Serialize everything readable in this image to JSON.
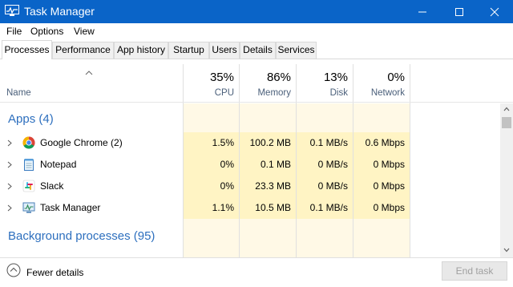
{
  "window": {
    "title": "Task Manager",
    "app_icon": "task-manager-icon"
  },
  "menu": [
    "File",
    "Options",
    "View"
  ],
  "tabs": [
    {
      "label": "Processes",
      "active": true
    },
    {
      "label": "Performance",
      "active": false
    },
    {
      "label": "App history",
      "active": false
    },
    {
      "label": "Startup",
      "active": false
    },
    {
      "label": "Users",
      "active": false
    },
    {
      "label": "Details",
      "active": false
    },
    {
      "label": "Services",
      "active": false
    }
  ],
  "columns": {
    "name": {
      "label": "Name"
    },
    "cpu": {
      "percent": "35%",
      "label": "CPU"
    },
    "memory": {
      "percent": "86%",
      "label": "Memory"
    },
    "disk": {
      "percent": "13%",
      "label": "Disk"
    },
    "network": {
      "percent": "0%",
      "label": "Network"
    }
  },
  "groups": {
    "apps": {
      "title": "Apps (4)",
      "rows": [
        {
          "name": "Google Chrome (2)",
          "icon": "chrome-icon",
          "cpu": "1.5%",
          "memory": "100.2 MB",
          "disk": "0.1 MB/s",
          "network": "0.6 Mbps"
        },
        {
          "name": "Notepad",
          "icon": "notepad-icon",
          "cpu": "0%",
          "memory": "0.1 MB",
          "disk": "0 MB/s",
          "network": "0 Mbps"
        },
        {
          "name": "Slack",
          "icon": "slack-icon",
          "cpu": "0%",
          "memory": "23.3 MB",
          "disk": "0 MB/s",
          "network": "0 Mbps"
        },
        {
          "name": "Task Manager",
          "icon": "task-manager-icon",
          "cpu": "1.1%",
          "memory": "10.5 MB",
          "disk": "0.1 MB/s",
          "network": "0 Mbps"
        }
      ]
    },
    "background": {
      "title": "Background processes (95)"
    }
  },
  "footer": {
    "fewer_details": "Fewer details",
    "end_task": "End task"
  },
  "colors": {
    "titlebar": "#0a64c8",
    "group_title": "#2d6fbe",
    "heat_light": "#fff9e6",
    "heat_cell": "#fff4c4"
  }
}
